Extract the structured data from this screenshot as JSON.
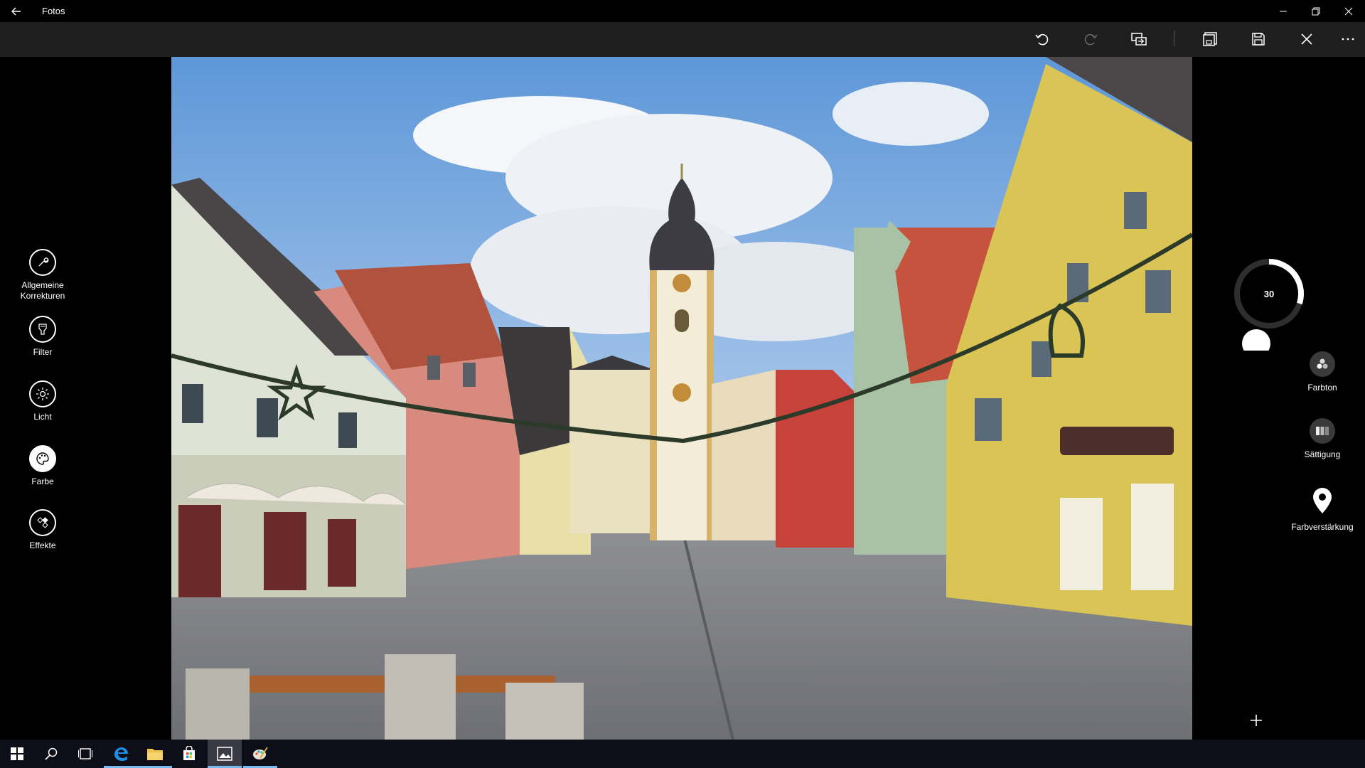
{
  "window": {
    "title": "Fotos"
  },
  "toolbar": {
    "icons": [
      "undo-icon",
      "redo-icon",
      "compare-icon",
      "save-copy-icon",
      "save-icon",
      "close-icon",
      "more-icon"
    ]
  },
  "left_tools": [
    {
      "label_line1": "Allgemeine",
      "label_line2": "Korrekturen",
      "icon": "wrench-icon"
    },
    {
      "label": "Filter",
      "icon": "filter-icon"
    },
    {
      "label": "Licht",
      "icon": "sun-icon"
    },
    {
      "label": "Farbe",
      "icon": "palette-icon",
      "active": true
    },
    {
      "label": "Effekte",
      "icon": "effects-icon"
    }
  ],
  "dial": {
    "value": "30",
    "fraction": 0.3
  },
  "right_options": [
    {
      "label": "Farbton",
      "icon": "hue-icon"
    },
    {
      "label": "Sättigung",
      "icon": "saturation-icon"
    },
    {
      "label": "Farbverstärkung",
      "icon": "color-boost-pin-icon"
    }
  ],
  "colors": {
    "accent": "#76b9ed",
    "toolbar_bg": "#1f1f1f",
    "taskbar_bg": "#0e0e18"
  }
}
